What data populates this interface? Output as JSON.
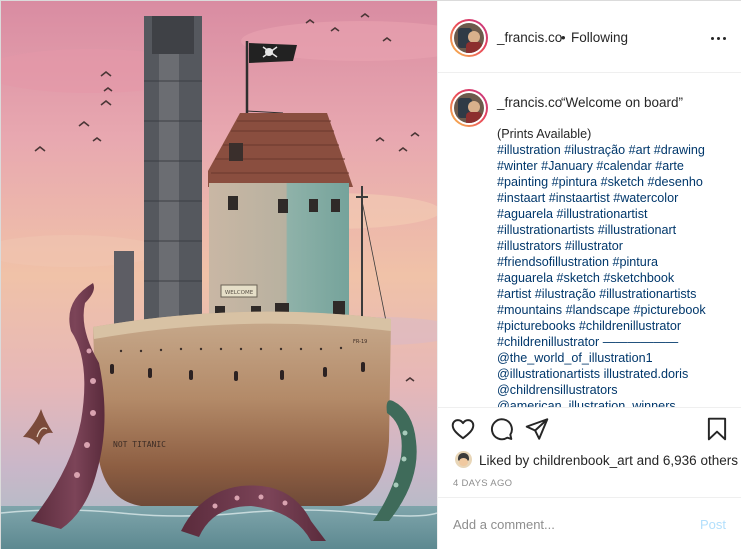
{
  "post": {
    "username": "_francis.co",
    "separator": "•",
    "follow_status": "Following",
    "more_icon": "ellipsis-icon"
  },
  "illustration": {
    "flag_text": "",
    "hull_text": "NOT TITANIC",
    "sign_text": "WELCOME",
    "stern_text": "FR-19"
  },
  "caption": {
    "username": "_francis.co",
    "quote": "“Welcome on board”",
    "lines": [
      "(Prints Available)",
      "#illustration #ilustração #art #drawing",
      "#winter #January #calendar #arte",
      "#painting #pintura #sketch #desenho",
      "#instaart #instaartist #watercolor",
      "#aguarela #illustrationartist",
      "#illustrationartists #illustrationart",
      "#illustrators #illustrator",
      "#friendsofillustration #pintura",
      "#aguarela #sketch #sketchbook",
      "#artist #ilustração #illustrationartists",
      "#mountains #landscape #picturebook",
      "#picturebooks #childrenillustrator",
      "#childrenillustrator ——————",
      "@the_world_of_illustration1",
      "@illustrationartists illustrated.doris",
      "@childrensillustrators",
      "@american_illustration_winners"
    ]
  },
  "actions": {
    "like_icon": "heart-icon",
    "comment_icon": "comment-icon",
    "share_icon": "share-icon",
    "save_icon": "bookmark-icon"
  },
  "likes": {
    "prefix": "Liked by ",
    "user": "childrenbook_art",
    "middle": " and ",
    "count": "6,936 others"
  },
  "timestamp": "4 DAYS AGO",
  "comment_box": {
    "placeholder": "Add a comment...",
    "post_label": "Post"
  },
  "colors": {
    "link": "#00376b",
    "post_button_disabled": "#b2dffc",
    "meta_grey": "#8e8e8e"
  }
}
